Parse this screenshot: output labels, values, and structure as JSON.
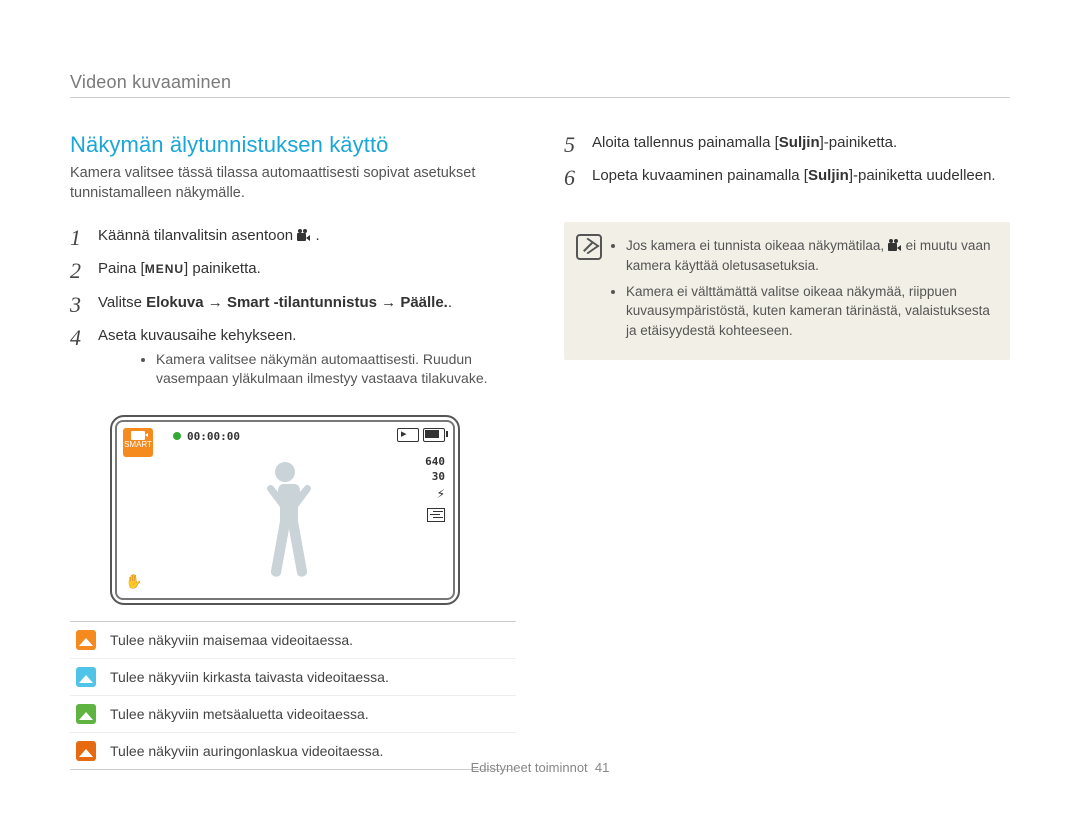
{
  "header": {
    "breadcrumb": "Videon kuvaaminen"
  },
  "left": {
    "section_title": "Näkymän älytunnistuksen käyttö",
    "intro": "Kamera valitsee tässä tilassa automaattisesti sopivat asetukset tunnistamalleen näkymälle.",
    "steps": {
      "s1": {
        "num": "1",
        "pre": "Käännä tilanvalitsin asentoon ",
        "post": "."
      },
      "s2": {
        "num": "2",
        "pre": "Paina [",
        "menu": "MENU",
        "post": "] painiketta."
      },
      "s3": {
        "num": "3",
        "pre": "Valitse ",
        "b1": "Elokuva",
        "arrow1": " → ",
        "b2": "Smart -tilantunnistus",
        "arrow2": " → ",
        "b3": "Päälle.",
        "post": "."
      },
      "s4": {
        "num": "4",
        "text": "Aseta kuvausaihe kehykseen.",
        "sub": "Kamera valitsee näkymän automaattisesti. Ruudun vasempaan yläkulmaan ilmestyy vastaava tilakuvake."
      }
    },
    "lcd": {
      "time": "00:00:00",
      "res": "640",
      "fps": "30"
    },
    "icon_table": [
      {
        "color": "orange",
        "name": "landscape-icon",
        "text": "Tulee näkyviin maisemaa videoitaessa."
      },
      {
        "color": "cyan",
        "name": "sky-icon",
        "text": "Tulee näkyviin kirkasta taivasta videoitaessa."
      },
      {
        "color": "green",
        "name": "forest-icon",
        "text": "Tulee näkyviin metsäaluetta videoitaessa."
      },
      {
        "color": "dkorange",
        "name": "sunset-icon",
        "text": "Tulee näkyviin auringonlaskua videoitaessa."
      }
    ]
  },
  "right": {
    "steps": {
      "s5": {
        "num": "5",
        "pre": "Aloita tallennus painamalla [",
        "b": "Suljin",
        "post": "]-painiketta."
      },
      "s6": {
        "num": "6",
        "pre": "Lopeta kuvaaminen painamalla [",
        "b": "Suljin",
        "post": "]-painiketta uudelleen."
      }
    },
    "note": {
      "li1_pre": "Jos kamera ei tunnista oikeaa näkymätilaa, ",
      "li1_post": " ei muutu vaan kamera käyttää oletusasetuksia.",
      "li2": "Kamera ei välttämättä valitse oikeaa näkymää, riippuen kuvausympäristöstä, kuten kameran tärinästä, valaistuksesta ja etäisyydestä kohteeseen."
    }
  },
  "footer": {
    "text": "Edistyneet toiminnot",
    "page": "41"
  }
}
